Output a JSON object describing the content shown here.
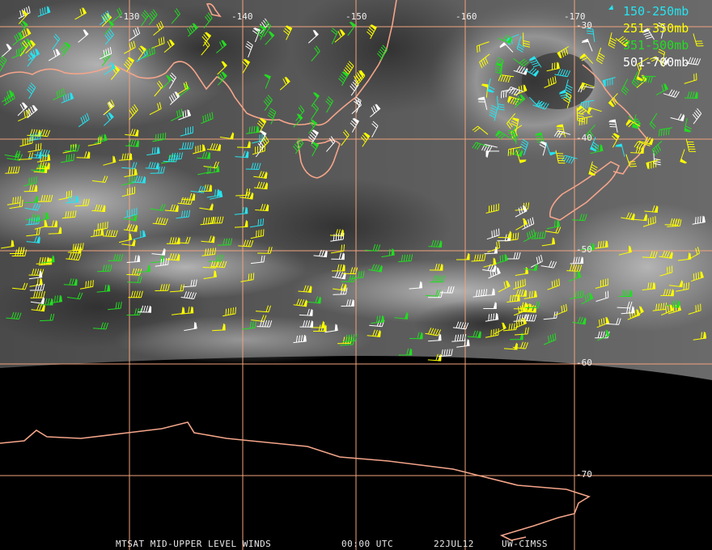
{
  "legend": [
    {
      "label": "150-250mb",
      "color": "#27e3ef"
    },
    {
      "label": "251-350mb",
      "color": "#ffff00"
    },
    {
      "label": "351-500mb",
      "color": "#22dd22"
    },
    {
      "label": "501-700mb",
      "color": "#ffffff"
    }
  ],
  "longitude_labels": [
    "-130",
    "-140",
    "-150",
    "-160",
    "-170"
  ],
  "latitude_labels": [
    "-30",
    "-40",
    "-50",
    "-60",
    "-70"
  ],
  "footer": {
    "product": "MTSAT MID-UPPER LEVEL WINDS",
    "time": "00:00 UTC",
    "date": "22JUL12",
    "source": "UW-CIMSS"
  },
  "colors": {
    "grid": "#f2a37e",
    "coast": "#f5a58a",
    "space": "#000000"
  }
}
